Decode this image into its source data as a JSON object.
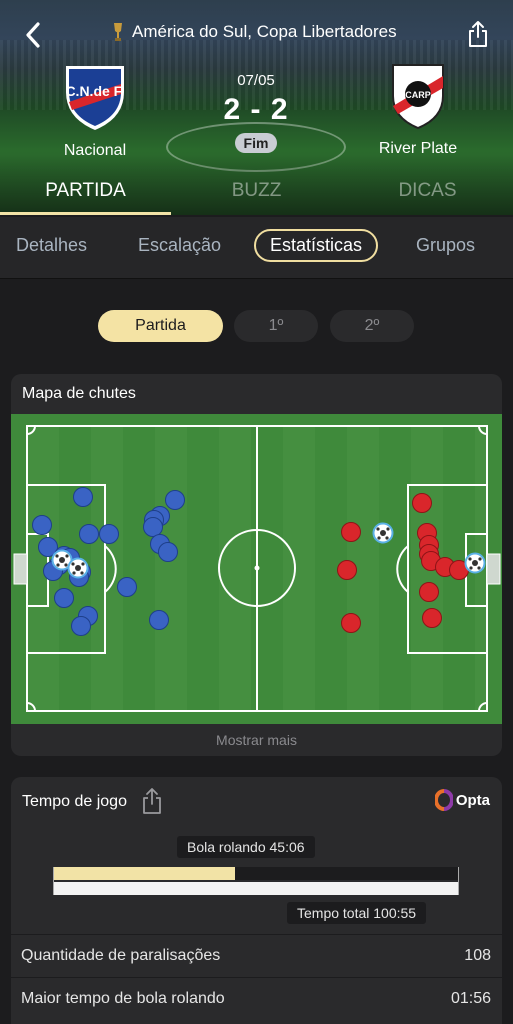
{
  "header": {
    "league": "América do Sul, Copa Libertadores",
    "date": "07/05",
    "score": "2 - 2",
    "status": "Fim",
    "home_team": "Nacional",
    "away_team": "River Plate",
    "home_crest_text": "C.N.de F.",
    "away_crest_text": "CARP"
  },
  "main_tabs": [
    "PARTIDA",
    "BUZZ",
    "DICAS"
  ],
  "sub_tabs": [
    "Detalhes",
    "Escalação",
    "Estatísticas",
    "Grupos"
  ],
  "period_pills": [
    "Partida",
    "1º",
    "2º"
  ],
  "shot_map": {
    "title": "Mapa de chutes",
    "show_more": "Mostrar mais",
    "home_color": "#3a63c4",
    "away_color": "#d9262b",
    "field_color": "#3f8a3b"
  },
  "time_card": {
    "title": "Tempo de jogo",
    "provider": "Opta",
    "ball_in_play_label": "Bola rolando 45:06",
    "total_label": "Tempo total 100:55",
    "ball_in_play_fraction": 0.447,
    "rows": [
      {
        "label": "Quantidade de paralisações",
        "value": "108"
      },
      {
        "label": "Maior tempo de bola rolando",
        "value": "01:56"
      }
    ]
  }
}
